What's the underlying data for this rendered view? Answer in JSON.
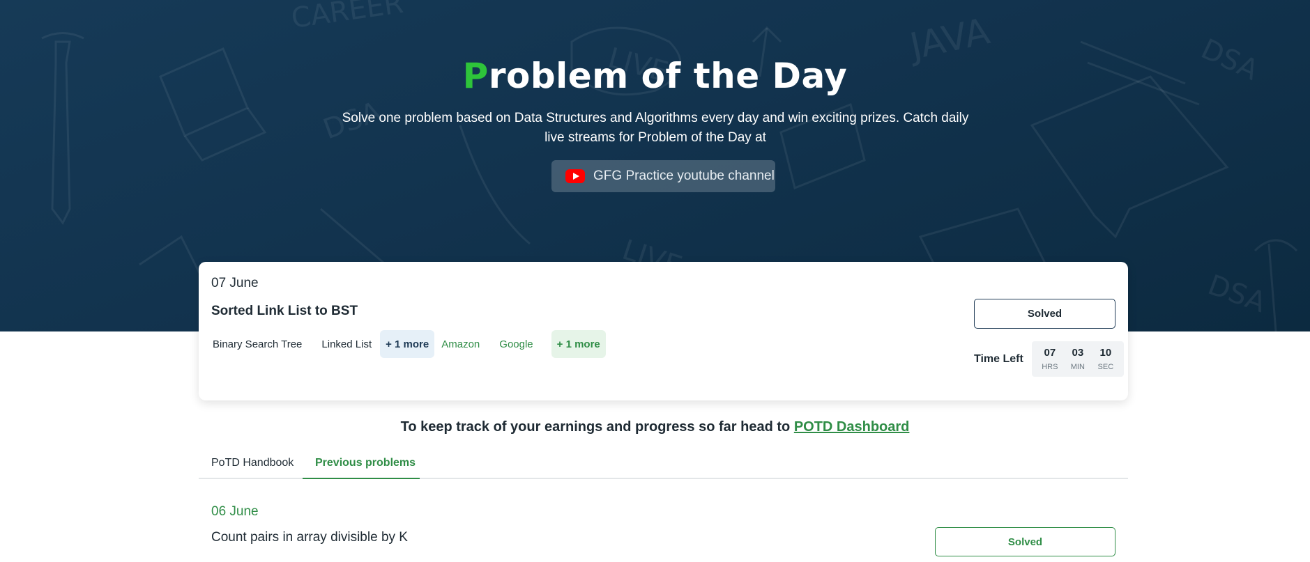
{
  "hero": {
    "title_mark": "P",
    "title_rest": "roblem of the Day",
    "description": "Solve one problem based on Data Structures and Algorithms every day and win exciting prizes. Catch daily live streams for Problem of the Day at",
    "youtube_button": "GFG Practice youtube channel",
    "doodle_words": [
      "CAREER",
      "LIVE",
      "JAVA",
      "DSA",
      "DSA",
      "DSA",
      "LIVE"
    ]
  },
  "today": {
    "date": "07 June",
    "title": "Sorted Link List to BST",
    "topic_tags": [
      "Binary Search Tree",
      "Linked List"
    ],
    "topic_more": "+ 1 more",
    "company_tags": [
      "Amazon",
      "Google"
    ],
    "company_more": "+ 1 more",
    "status_button": "Solved",
    "timer": {
      "label": "Time Left",
      "hours": "07",
      "hours_label": "HRS",
      "minutes": "03",
      "minutes_label": "MIN",
      "seconds": "10",
      "seconds_label": "SEC"
    }
  },
  "track": {
    "text": "To keep track of your earnings and progress so far head to ",
    "link": "POTD Dashboard"
  },
  "tabs": {
    "handbook": "PoTD Handbook",
    "previous": "Previous problems"
  },
  "previous_problem": {
    "date": "06 June",
    "title": "Count pairs in array divisible by K",
    "status_button": "Solved"
  },
  "colors": {
    "brand_green": "#2f8d46",
    "hero_bg": "#12334e",
    "title_mark": "#2ec43a"
  }
}
